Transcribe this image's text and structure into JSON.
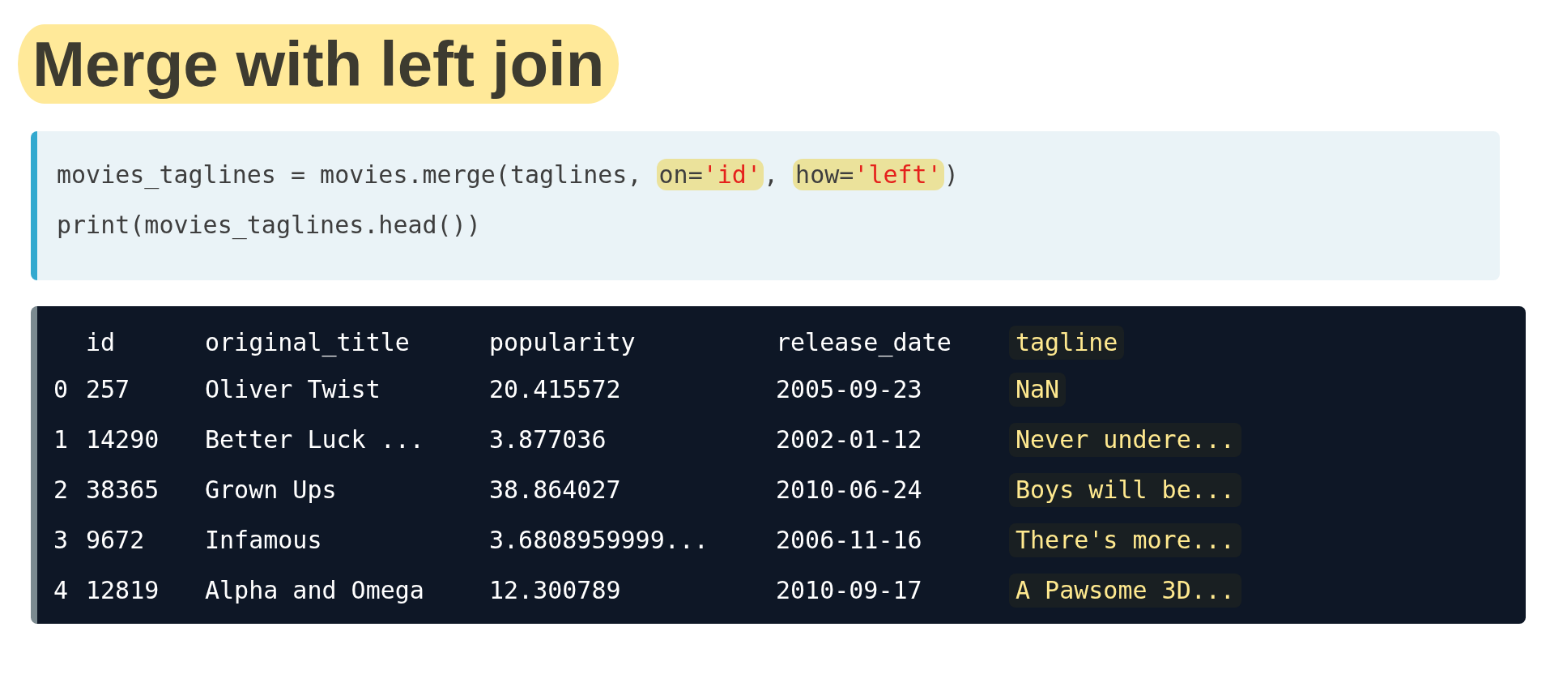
{
  "title": "Merge with left join",
  "code": {
    "lines": [
      [
        {
          "kind": "text",
          "text": "movies_taglines = movies.merge(taglines, "
        },
        {
          "kind": "arg",
          "name": "on=",
          "value": "'id'"
        },
        {
          "kind": "text",
          "text": ", "
        },
        {
          "kind": "arg",
          "name": "how=",
          "value": "'left'"
        },
        {
          "kind": "text",
          "text": ")"
        }
      ],
      [
        {
          "kind": "text",
          "text": "print(movies_taglines.head())"
        }
      ]
    ]
  },
  "output": {
    "columns": [
      {
        "label": "id",
        "highlighted": false
      },
      {
        "label": "original_title",
        "highlighted": false
      },
      {
        "label": "popularity",
        "highlighted": false
      },
      {
        "label": "release_date",
        "highlighted": false
      },
      {
        "label": "tagline",
        "highlighted": true
      }
    ],
    "rows": [
      {
        "index": "0",
        "cells": [
          "257",
          "Oliver Twist",
          "20.415572",
          "2005-09-23",
          "NaN"
        ]
      },
      {
        "index": "1",
        "cells": [
          "14290",
          "Better Luck ...",
          "3.877036",
          "2002-01-12",
          "Never undere..."
        ]
      },
      {
        "index": "2",
        "cells": [
          "38365",
          "Grown Ups",
          "38.864027",
          "2010-06-24",
          "Boys will be..."
        ]
      },
      {
        "index": "3",
        "cells": [
          "9672",
          "Infamous",
          "3.6808959999...",
          "2006-11-16",
          "There's more..."
        ]
      },
      {
        "index": "4",
        "cells": [
          "12819",
          "Alpha and Omega",
          "12.300789",
          "2010-09-17",
          "A Pawsome 3D..."
        ]
      }
    ]
  }
}
